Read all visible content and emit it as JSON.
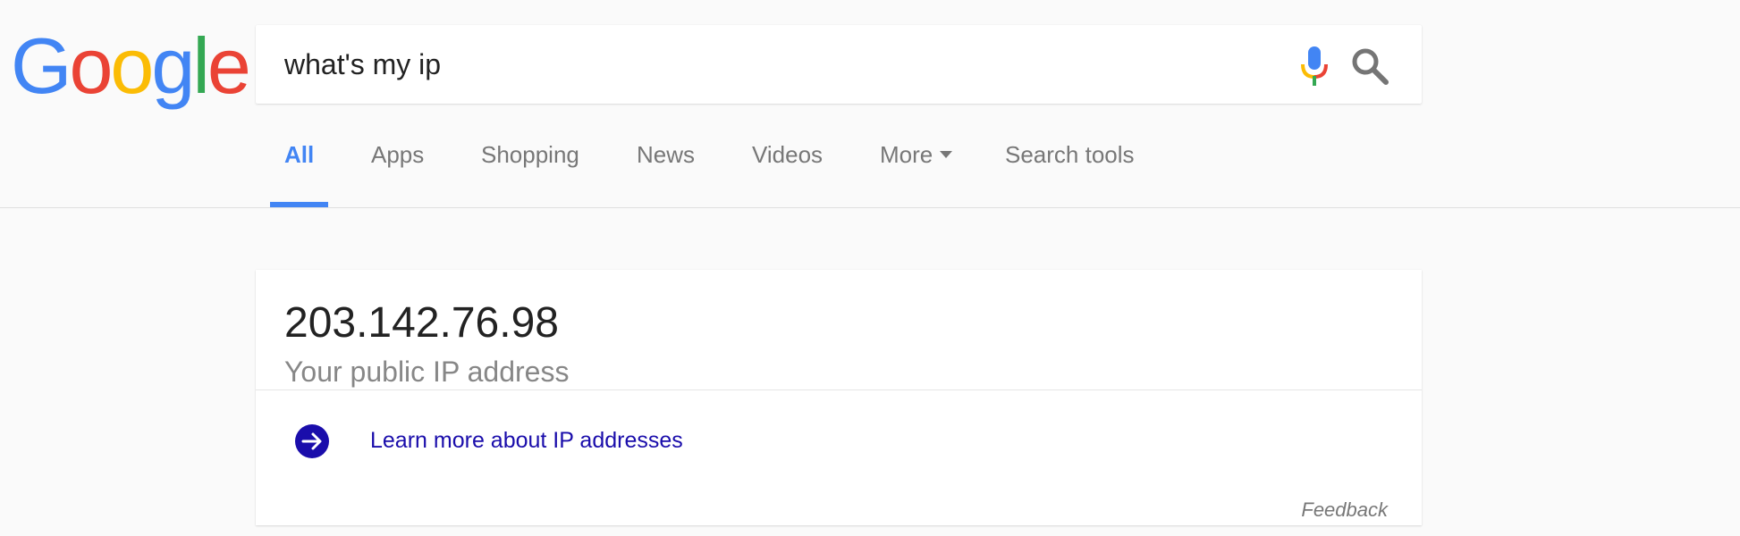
{
  "logo": {
    "letters": [
      "G",
      "o",
      "o",
      "g",
      "l",
      "e"
    ],
    "colors": [
      "#4285f4",
      "#ea4335",
      "#fbbc05",
      "#4285f4",
      "#34a853",
      "#ea4335"
    ]
  },
  "search": {
    "query": "what's my ip",
    "mic_icon": "microphone-icon",
    "search_icon": "magnifier-icon"
  },
  "tabs": [
    {
      "label": "All",
      "active": true
    },
    {
      "label": "Apps",
      "active": false
    },
    {
      "label": "Shopping",
      "active": false
    },
    {
      "label": "News",
      "active": false
    },
    {
      "label": "Videos",
      "active": false
    },
    {
      "label": "More",
      "active": false,
      "dropdown": true
    },
    {
      "label": "Search tools",
      "active": false
    }
  ],
  "result": {
    "ip": "203.142.76.98",
    "caption": "Your public IP address",
    "learn_more": "Learn more about IP addresses",
    "learn_more_icon": "arrow-circle-right-icon",
    "feedback": "Feedback"
  },
  "colors": {
    "accent": "#4285f4",
    "link": "#1a0dab",
    "arrow_fill": "#1a0dab",
    "background": "#fafafa"
  }
}
